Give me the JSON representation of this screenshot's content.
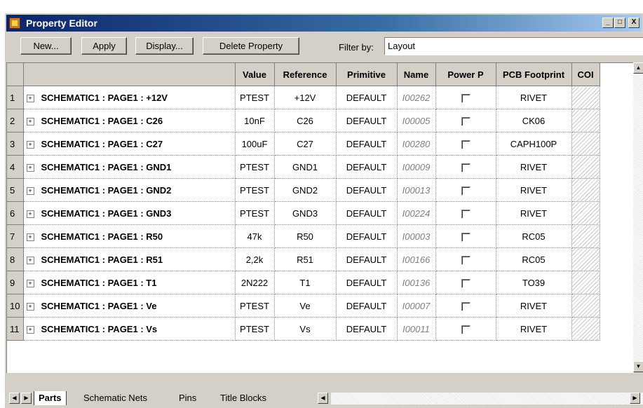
{
  "window": {
    "title": "Property Editor",
    "minimize_glyph": "_",
    "restore_glyph": "□",
    "close_glyph": "X"
  },
  "toolbar": {
    "new_label": "New...",
    "apply_label": "Apply",
    "display_label": "Display...",
    "delete_label": "Delete Property",
    "filter_label": "Filter by:",
    "filter_value": "Layout"
  },
  "grid": {
    "columns": [
      "",
      "",
      "Value",
      "Reference",
      "Primitive",
      "Name",
      "Power P",
      "PCB Footprint",
      "COI"
    ],
    "rows": [
      {
        "num": "1",
        "part": "SCHEMATIC1 : PAGE1 : +12V",
        "value": "PTEST",
        "reference": "+12V",
        "primitive": "DEFAULT",
        "name": "I00262",
        "footprint": "RIVET"
      },
      {
        "num": "2",
        "part": "SCHEMATIC1 : PAGE1 : C26",
        "value": "10nF",
        "reference": "C26",
        "primitive": "DEFAULT",
        "name": "I00005",
        "footprint": "CK06"
      },
      {
        "num": "3",
        "part": "SCHEMATIC1 : PAGE1 : C27",
        "value": "100uF",
        "reference": "C27",
        "primitive": "DEFAULT",
        "name": "I00280",
        "footprint": "CAPH100P"
      },
      {
        "num": "4",
        "part": "SCHEMATIC1 : PAGE1 : GND1",
        "value": "PTEST",
        "reference": "GND1",
        "primitive": "DEFAULT",
        "name": "I00009",
        "footprint": "RIVET"
      },
      {
        "num": "5",
        "part": "SCHEMATIC1 : PAGE1 : GND2",
        "value": "PTEST",
        "reference": "GND2",
        "primitive": "DEFAULT",
        "name": "I00013",
        "footprint": "RIVET"
      },
      {
        "num": "6",
        "part": "SCHEMATIC1 : PAGE1 : GND3",
        "value": "PTEST",
        "reference": "GND3",
        "primitive": "DEFAULT",
        "name": "I00224",
        "footprint": "RIVET"
      },
      {
        "num": "7",
        "part": "SCHEMATIC1 : PAGE1 : R50",
        "value": "47k",
        "reference": "R50",
        "primitive": "DEFAULT",
        "name": "I00003",
        "footprint": "RC05"
      },
      {
        "num": "8",
        "part": "SCHEMATIC1 : PAGE1 : R51",
        "value": "2,2k",
        "reference": "R51",
        "primitive": "DEFAULT",
        "name": "I00166",
        "footprint": "RC05"
      },
      {
        "num": "9",
        "part": "SCHEMATIC1 : PAGE1 : T1",
        "value": "2N222",
        "reference": "T1",
        "primitive": "DEFAULT",
        "name": "I00136",
        "footprint": "TO39"
      },
      {
        "num": "10",
        "part": "SCHEMATIC1 : PAGE1 : Ve",
        "value": "PTEST",
        "reference": "Ve",
        "primitive": "DEFAULT",
        "name": "I00007",
        "footprint": "RIVET"
      },
      {
        "num": "11",
        "part": "SCHEMATIC1 : PAGE1 : Vs",
        "value": "PTEST",
        "reference": "Vs",
        "primitive": "DEFAULT",
        "name": "I00011",
        "footprint": "RIVET"
      }
    ]
  },
  "tabs": [
    "Parts",
    "Schematic Nets",
    "Pins",
    "Title Blocks"
  ],
  "active_tab": "Parts",
  "icons": {
    "expand": "+",
    "scroll_up": "▲",
    "scroll_down": "▼",
    "scroll_left": "◀",
    "scroll_right": "▶"
  },
  "colors": {
    "title_bar_start": "#0a246a",
    "chrome": "#d4d0c8",
    "name_text": "#808080"
  }
}
